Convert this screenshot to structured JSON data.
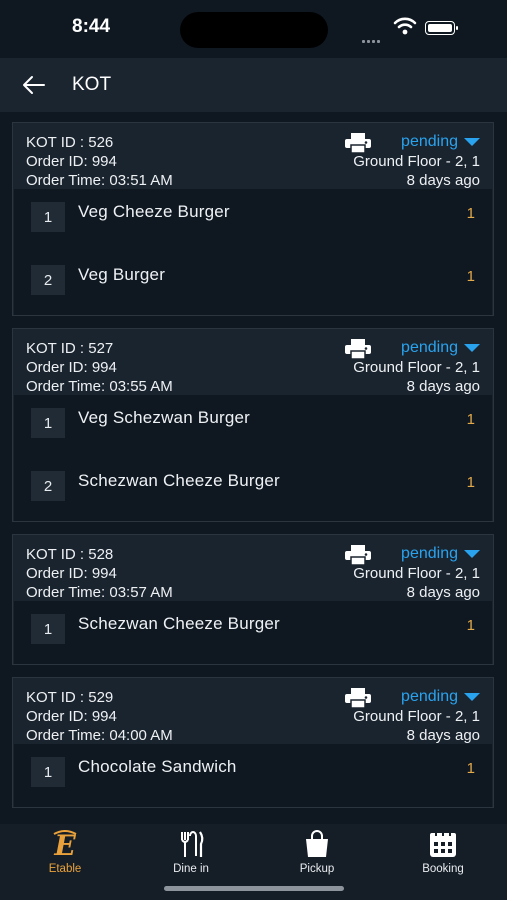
{
  "status_bar": {
    "time": "8:44"
  },
  "header": {
    "title": "KOT"
  },
  "kots": [
    {
      "kot_id": "KOT ID : 526",
      "order_id": "Order ID: 994",
      "order_time": "Order Time: 03:51 AM",
      "status": "pending",
      "location": "Ground Floor - 2, 1",
      "ago": "8 days ago",
      "items": [
        {
          "no": "1",
          "name": "Veg Cheeze Burger",
          "qty": "1"
        },
        {
          "no": "2",
          "name": "Veg Burger",
          "qty": "1"
        }
      ]
    },
    {
      "kot_id": "KOT ID : 527",
      "order_id": "Order ID: 994",
      "order_time": "Order Time: 03:55 AM",
      "status": "pending",
      "location": "Ground Floor - 2, 1",
      "ago": "8 days ago",
      "items": [
        {
          "no": "1",
          "name": "Veg Schezwan Burger",
          "qty": "1"
        },
        {
          "no": "2",
          "name": "Schezwan Cheeze Burger",
          "qty": "1"
        }
      ]
    },
    {
      "kot_id": "KOT ID : 528",
      "order_id": "Order ID: 994",
      "order_time": "Order Time: 03:57 AM",
      "status": "pending",
      "location": "Ground Floor - 2, 1",
      "ago": "8 days ago",
      "items": [
        {
          "no": "1",
          "name": "Schezwan Cheeze Burger",
          "qty": "1"
        }
      ]
    },
    {
      "kot_id": "KOT ID : 529",
      "order_id": "Order ID: 994",
      "order_time": "Order Time: 04:00 AM",
      "status": "pending",
      "location": "Ground Floor - 2, 1",
      "ago": "8 days ago",
      "items": [
        {
          "no": "1",
          "name": "Chocolate Sandwich",
          "qty": "1"
        }
      ]
    }
  ],
  "tabs": [
    {
      "label": "Etable",
      "icon": "etable-logo-icon",
      "active": true
    },
    {
      "label": "Dine in",
      "icon": "fork-knife-icon",
      "active": false
    },
    {
      "label": "Pickup",
      "icon": "shopping-bag-icon",
      "active": false
    },
    {
      "label": "Booking",
      "icon": "calendar-icon",
      "active": false
    }
  ],
  "colors": {
    "background": "#0f1821",
    "card": "#1a242e",
    "accent": "#2aa3ef",
    "qty": "#e2a94a",
    "active_tab": "#e9a13b"
  }
}
